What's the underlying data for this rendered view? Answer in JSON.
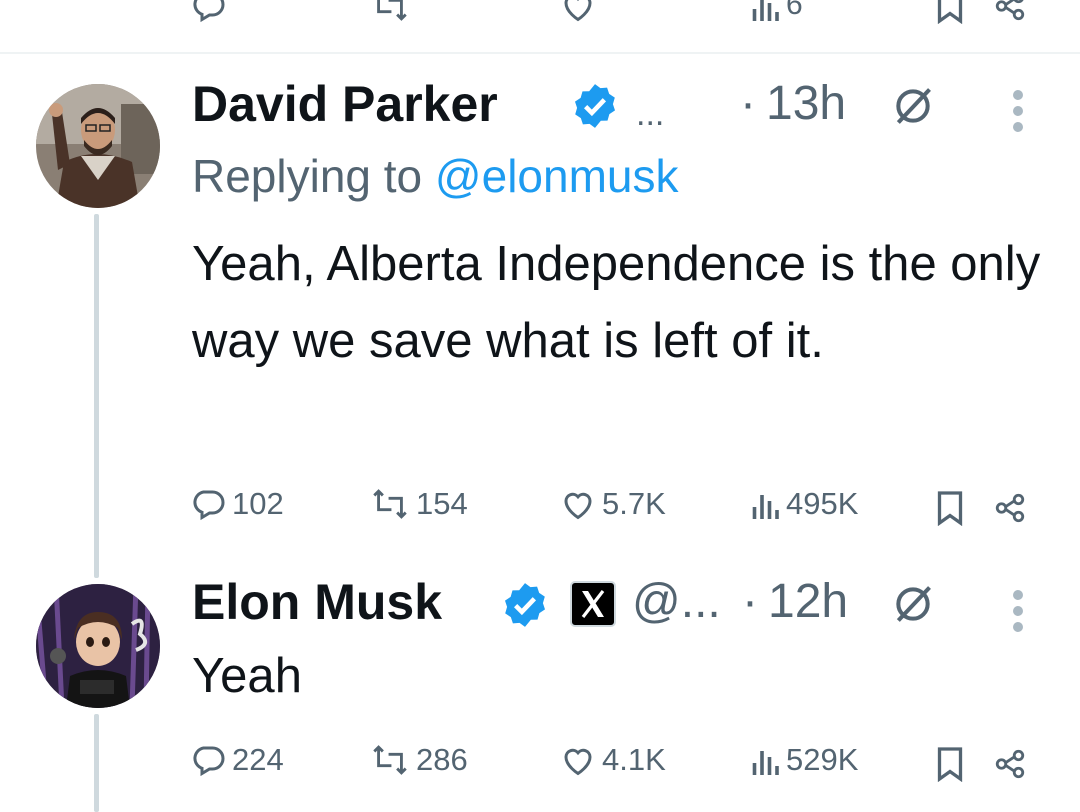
{
  "prev_tweet_actions": {
    "views_count": "6"
  },
  "tweets": [
    {
      "author_name": "David Parker",
      "handle_truncated": "...",
      "separator": "·",
      "time": "13h",
      "replying_prefix": "Replying to ",
      "replying_handle": "@elonmusk",
      "text": "Yeah, Alberta Independence is the only way we save what is left of it.",
      "replies": "102",
      "reposts": "154",
      "likes": "5.7K",
      "views": "495K"
    },
    {
      "author_name": "Elon Musk",
      "handle_truncated": "@...",
      "separator": "·",
      "time": "12h",
      "text": "Yeah",
      "replies": "224",
      "reposts": "286",
      "likes": "4.1K",
      "views": "529K"
    }
  ],
  "colors": {
    "accent": "#1d9bf0",
    "muted": "#536471",
    "thread_line": "#cfd9de"
  }
}
